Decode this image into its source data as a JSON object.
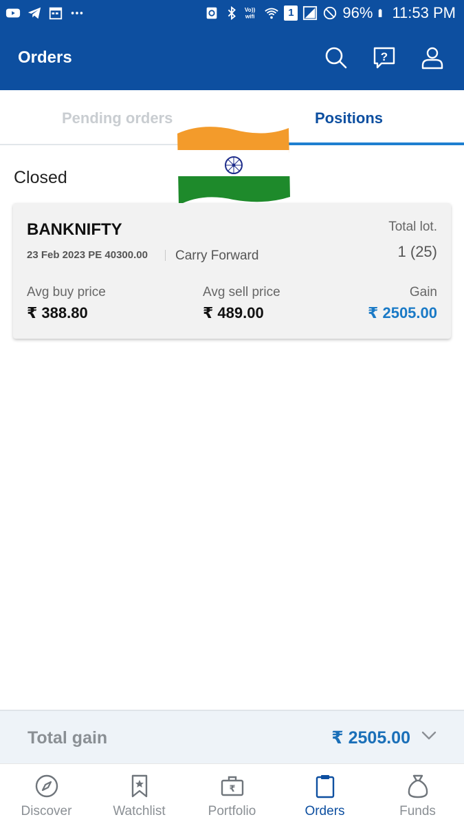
{
  "status_bar": {
    "battery_percent": "96%",
    "time": "11:53 PM",
    "volte_label": "Vo))\nwifi",
    "sim_badge": "1",
    "left_icons": [
      "youtube-icon",
      "telegram-icon",
      "calendar-icon",
      "more-dots-icon"
    ],
    "right_icons": [
      "recycle-icon",
      "bluetooth-icon",
      "wifi-calling-icon",
      "wifi-icon",
      "sim-icon",
      "signal-icon",
      "dnd-icon",
      "battery-icon"
    ]
  },
  "header": {
    "title": "Orders",
    "icons": [
      "search-icon",
      "help-chat-icon",
      "profile-icon"
    ]
  },
  "tabs": [
    {
      "label": "Pending orders",
      "active": false
    },
    {
      "label": "Positions",
      "active": true
    }
  ],
  "section": {
    "title": "Closed"
  },
  "position": {
    "symbol": "BANKNIFTY",
    "contract": "23 Feb 2023 PE 40300.00",
    "product": "Carry Forward",
    "total_lot_label": "Total lot.",
    "total_lot_value": "1 (25)",
    "avg_buy_label": "Avg buy price",
    "avg_buy_value": "₹ 388.80",
    "avg_sell_label": "Avg sell price",
    "avg_sell_value": "₹ 489.00",
    "gain_label": "Gain",
    "gain_value": "₹ 2505.00"
  },
  "total": {
    "label": "Total gain",
    "value": "₹ 2505.00"
  },
  "bottom_nav": [
    {
      "label": "Discover",
      "icon": "compass-icon",
      "active": false
    },
    {
      "label": "Watchlist",
      "icon": "bookmark-icon",
      "active": false
    },
    {
      "label": "Portfolio",
      "icon": "briefcase-icon",
      "active": false
    },
    {
      "label": "Orders",
      "icon": "clipboard-icon",
      "active": true
    },
    {
      "label": "Funds",
      "icon": "money-bag-icon",
      "active": false
    }
  ],
  "colors": {
    "brand_blue": "#0d4fa0",
    "accent_blue": "#1a7ac6",
    "tab_inactive": "#c9cdd1",
    "nav_inactive": "#8a8f94",
    "flag_saffron": "#f39b2b",
    "flag_green": "#1e8a2b",
    "chakra_navy": "#1d2c8a"
  }
}
